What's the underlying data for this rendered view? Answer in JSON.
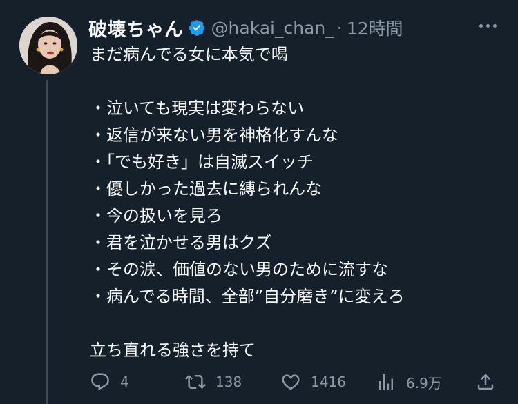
{
  "tweet": {
    "author": {
      "display_name": "破壊ちゃん",
      "handle": "@hakai_chan_",
      "verified": true
    },
    "separator": "·",
    "time": "12時間",
    "lines": [
      "まだ病んでる女に本気で喝",
      "",
      "・泣いても現実は変わらない",
      "・返信が来ない男を神格化すんな",
      "・「でも好き」は自滅スイッチ",
      "・優しかった過去に縛られんな",
      "・今の扱いを見ろ",
      "・君を泣かせる男はクズ",
      "・その涙、価値のない男のために流すな",
      "・病んでる時間、全部”自分磨き”に変えろ",
      "",
      "立ち直れる強さを持て"
    ],
    "stats": {
      "replies": "4",
      "retweets": "138",
      "likes": "1416",
      "views": "6.9万"
    }
  },
  "icons": {
    "verified": "verified-badge-icon",
    "more": "more-icon",
    "reply": "reply-icon",
    "retweet": "retweet-icon",
    "like": "heart-icon",
    "views": "views-icon",
    "share": "share-icon"
  },
  "colors": {
    "background": "#15202b",
    "text": "#f7f9f9",
    "secondary": "#8b98a5",
    "verified": "#1d9bf0",
    "thread_line": "#3d4b57"
  }
}
